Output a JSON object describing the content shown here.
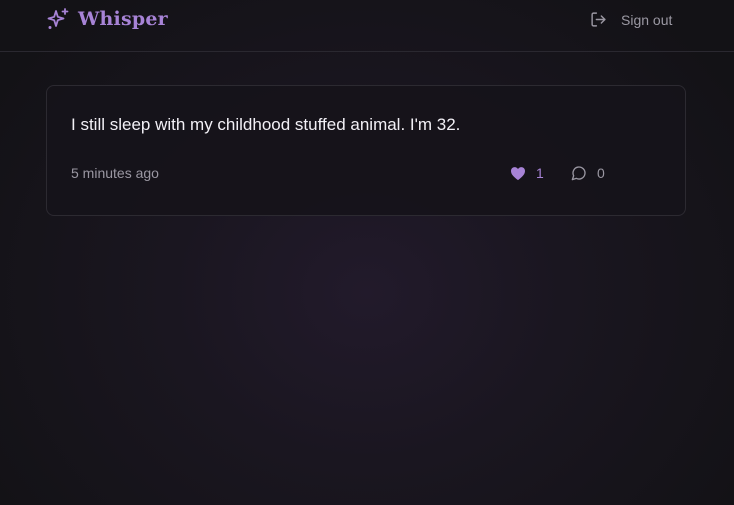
{
  "app": {
    "title": "Whisper",
    "logo_icon": "sparkles-icon",
    "accent_color": "#a783d6"
  },
  "header": {
    "signout_label": "Sign out",
    "signout_icon": "log-out-icon"
  },
  "post": {
    "text": "I still sleep with my childhood stuffed animal. I'm 32.",
    "timestamp": "5 minutes ago",
    "likes": "1",
    "like_icon": "heart-icon",
    "comments": "0",
    "comment_icon": "message-circle-icon"
  }
}
